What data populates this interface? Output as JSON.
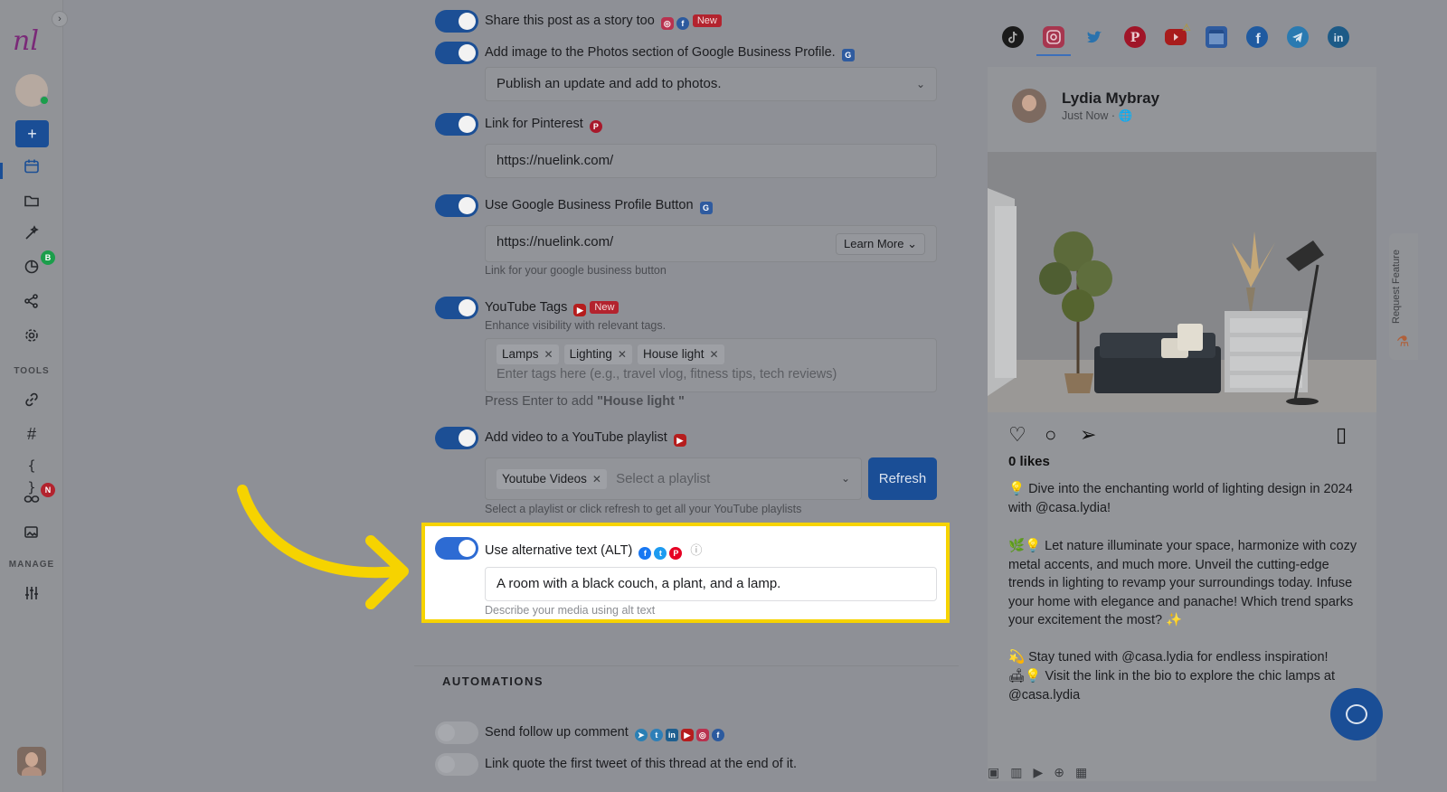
{
  "sidebar": {
    "logo": "nl",
    "collapse_icon": "›",
    "add_label": "+",
    "badges": {
      "analytics": "B",
      "links": "N"
    },
    "section_tools": "TOOLS",
    "section_manage": "MANAGE"
  },
  "options": {
    "story": {
      "label": "Share this post as a story too",
      "badge": "New"
    },
    "gbp_photos": {
      "label": "Add image to the Photos section of Google Business Profile.",
      "select_value": "Publish an update and add to photos."
    },
    "pinterest": {
      "label": "Link for Pinterest",
      "value": "https://nuelink.com/"
    },
    "gbp_button": {
      "label": "Use Google Business Profile Button",
      "value": "https://nuelink.com/",
      "button_type": "Learn More",
      "hint": "Link for your google business button"
    },
    "youtube_tags": {
      "label": "YouTube Tags",
      "badge": "New",
      "subtitle": "Enhance visibility with relevant tags.",
      "tags": [
        "Lamps",
        "Lighting",
        "House light"
      ],
      "placeholder": "Enter tags here (e.g., travel vlog, fitness tips, tech reviews)",
      "enter_hint_prefix": "Press Enter to add ",
      "enter_hint_value": "\"House light \""
    },
    "playlist": {
      "label": "Add video to a YouTube playlist",
      "selected_tag": "Youtube Videos",
      "placeholder": "Select a playlist",
      "refresh_label": "Refresh",
      "hint": "Select a playlist or click refresh to get all your YouTube playlists"
    },
    "alt_text": {
      "label": "Use alternative text (ALT)",
      "value": "A room with a black couch, a plant, and a lamp.",
      "hint": "Describe your media using alt text",
      "info_icon": "ⓘ"
    }
  },
  "automations": {
    "heading": "AUTOMATIONS",
    "follow_up": "Send follow up comment",
    "link_quote": "Link quote the first tweet of this thread at the end of it."
  },
  "preview": {
    "networks": [
      "tiktok",
      "instagram",
      "twitter",
      "pinterest",
      "youtube",
      "google-business",
      "facebook",
      "telegram",
      "linkedin"
    ],
    "active_network": "instagram",
    "user_name": "Lydia Mybray",
    "time": "Just Now · 🌐",
    "likes": "0 likes",
    "caption": [
      "💡 Dive into the enchanting world of lighting design in 2024 with @casa.lydia!",
      "🌿💡 Let nature illuminate your space, harmonize with cozy metal accents, and much more. Unveil the cutting-edge trends in lighting to revamp your surroundings today. Infuse your home with elegance and panache! Which trend sparks your excitement the most? ✨",
      "💫 Stay tuned with @casa.lydia for endless inspiration!",
      "🛋💡 Visit the link in the bio to explore the chic lamps at @casa.lydia"
    ],
    "request_feature": "Request Feature"
  },
  "colors": {
    "accent": "#2d6bd3",
    "highlight_border": "#f6d300",
    "arrow": "#f6d300",
    "badge_new": "#d63340"
  }
}
